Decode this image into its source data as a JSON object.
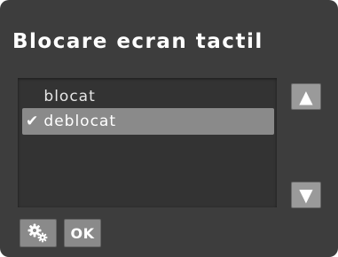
{
  "screen": {
    "title": "Blocare ecran tactil"
  },
  "options": {
    "items": [
      {
        "label": "blocat",
        "selected": false
      },
      {
        "label": "deblocat",
        "selected": true
      }
    ],
    "check_mark": "✔"
  },
  "scroll": {
    "up_glyph": "▲",
    "down_glyph": "▼"
  },
  "footer": {
    "settings_icon": "gears-icon",
    "ok_label": "OK"
  },
  "colors": {
    "background": "#3d3d3d",
    "list_background": "#333333",
    "selected_row": "#8a8a8a",
    "text": "#ffffff"
  }
}
